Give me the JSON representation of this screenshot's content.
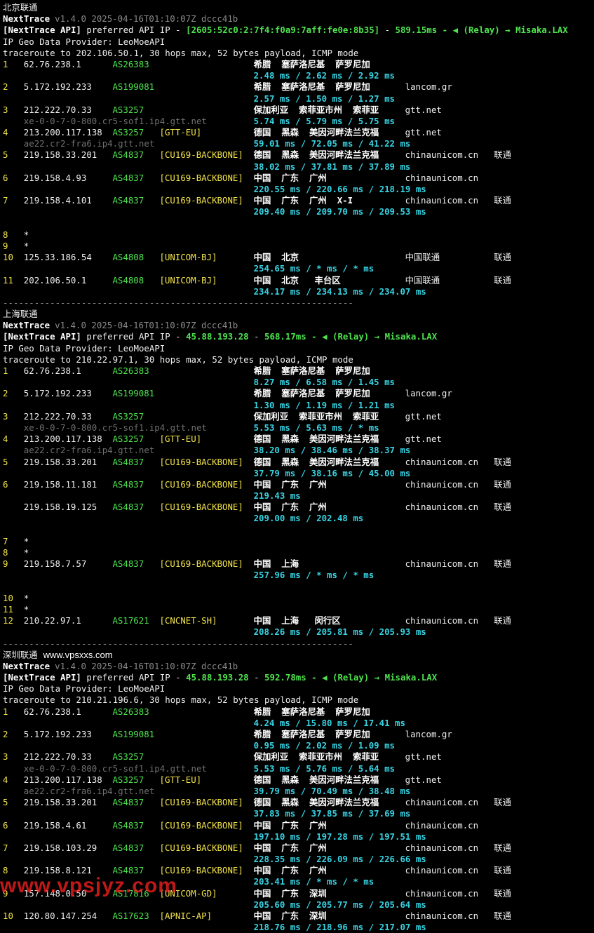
{
  "watermark": "www.vpsjyz.com",
  "site_tag": "www.vpsxxs.com",
  "blocks": [
    {
      "title": "北京联通",
      "version_name": "NextTrace",
      "version_info": "v1.4.0 2025-04-16T01:10:07Z dccc41b",
      "api_tag": "[NextTrace API]",
      "api_text": " preferred API IP - ",
      "api_ip": "[2605:52c0:2:7f4:f0a9:7aff:fe0e:8b35]",
      "api_sep": " - ",
      "api_latency": "589.15ms",
      "api_relay": " - ◀ (Relay) → Misaka.LAX",
      "geo_provider": "IP Geo Data Provider: LeoMoeAPI",
      "traceroute": "traceroute to 202.106.50.1, 30 hops max, 52 bytes payload, ICMP mode",
      "rows": [
        {
          "hop": "1",
          "ip": "62.76.238.1",
          "asn": "AS26383",
          "tag": "",
          "geo": "希腊  塞萨洛尼基  萨罗尼加",
          "domain": "",
          "isp": ""
        },
        {
          "rtt": "2.48 ms / 2.62 ms / 2.92 ms"
        },
        {
          "hop": "2",
          "ip": "5.172.192.233",
          "asn": "AS199081",
          "tag": "",
          "geo": "希腊  塞萨洛尼基  萨罗尼加",
          "domain": "lancom.gr",
          "isp": ""
        },
        {
          "rtt": "2.57 ms / 1.50 ms / 1.27 ms"
        },
        {
          "hop": "3",
          "ip": "212.222.70.33",
          "asn": "AS3257",
          "tag": "",
          "geo": "保加利亚  索菲亚市州  索菲亚",
          "domain": "gtt.net",
          "isp": ""
        },
        {
          "host": "xe-0-0-7-0-800.cr5-sof1.ip4.gtt.net",
          "rtt": "5.74 ms / 5.79 ms / 5.75 ms"
        },
        {
          "hop": "4",
          "ip": "213.200.117.138",
          "asn": "AS3257",
          "tag": "[GTT-EU]",
          "geo": "德国  黑森  美因河畔法兰克福",
          "domain": "gtt.net",
          "isp": ""
        },
        {
          "host": "ae22.cr2-fra6.ip4.gtt.net",
          "rtt": "59.01 ms / 72.05 ms / 41.22 ms"
        },
        {
          "hop": "5",
          "ip": "219.158.33.201",
          "asn": "AS4837",
          "tag": "[CU169-BACKBONE]",
          "geo": "德国  黑森  美因河畔法兰克福",
          "domain": "chinaunicom.cn",
          "isp": "联通"
        },
        {
          "rtt": "38.02 ms / 37.81 ms / 37.89 ms"
        },
        {
          "hop": "6",
          "ip": "219.158.4.93",
          "asn": "AS4837",
          "tag": "[CU169-BACKBONE]",
          "geo": "中国  广东  广州",
          "domain": "chinaunicom.cn",
          "isp": ""
        },
        {
          "rtt": "220.55 ms / 220.66 ms / 218.19 ms"
        },
        {
          "hop": "7",
          "ip": "219.158.4.101",
          "asn": "AS4837",
          "tag": "[CU169-BACKBONE]",
          "geo": "中国  广东  广州  X-I",
          "domain": "chinaunicom.cn",
          "isp": "联通"
        },
        {
          "rtt": "209.40 ms / 209.70 ms / 209.53 ms"
        },
        {
          "blank": true
        },
        {
          "hop": "8",
          "star": "*"
        },
        {
          "hop": "9",
          "star": "*"
        },
        {
          "hop": "10",
          "ip": "125.33.186.54",
          "asn": "AS4808",
          "tag": "[UNICOM-BJ]",
          "geo": "中国  北京",
          "domain": "中国联通",
          "isp": "联通"
        },
        {
          "rtt": "254.65 ms / * ms / * ms"
        },
        {
          "hop": "11",
          "ip": "202.106.50.1",
          "asn": "AS4808",
          "tag": "[UNICOM-BJ]",
          "geo": "中国  北京   丰台区",
          "domain": "中国联通",
          "isp": "联通"
        },
        {
          "rtt": "234.17 ms / 234.13 ms / 234.07 ms"
        }
      ],
      "separator": "-------------------------------------------------------------------"
    },
    {
      "title": "上海联通",
      "version_name": "NextTrace",
      "version_info": "v1.4.0 2025-04-16T01:10:07Z dccc41b",
      "api_tag": "[NextTrace API]",
      "api_text": " preferred API IP - ",
      "api_ip": "45.88.193.28",
      "api_sep": " - ",
      "api_latency": "568.17ms",
      "api_relay": " - ◀ (Relay) → Misaka.LAX",
      "geo_provider": "IP Geo Data Provider: LeoMoeAPI",
      "traceroute": "traceroute to 210.22.97.1, 30 hops max, 52 bytes payload, ICMP mode",
      "rows": [
        {
          "hop": "1",
          "ip": "62.76.238.1",
          "asn": "AS26383",
          "tag": "",
          "geo": "希腊  塞萨洛尼基  萨罗尼加",
          "domain": "",
          "isp": ""
        },
        {
          "rtt": "8.27 ms / 6.58 ms / 1.45 ms"
        },
        {
          "hop": "2",
          "ip": "5.172.192.233",
          "asn": "AS199081",
          "tag": "",
          "geo": "希腊  塞萨洛尼基  萨罗尼加",
          "domain": "lancom.gr",
          "isp": ""
        },
        {
          "rtt": "1.30 ms / 1.19 ms / 1.21 ms"
        },
        {
          "hop": "3",
          "ip": "212.222.70.33",
          "asn": "AS3257",
          "tag": "",
          "geo": "保加利亚  索菲亚市州  索菲亚",
          "domain": "gtt.net",
          "isp": ""
        },
        {
          "host": "xe-0-0-7-0-800.cr5-sof1.ip4.gtt.net",
          "rtt": "5.53 ms / 5.63 ms / * ms"
        },
        {
          "hop": "4",
          "ip": "213.200.117.138",
          "asn": "AS3257",
          "tag": "[GTT-EU]",
          "geo": "德国  黑森  美因河畔法兰克福",
          "domain": "gtt.net",
          "isp": ""
        },
        {
          "host": "ae22.cr2-fra6.ip4.gtt.net",
          "rtt": "38.20 ms / 38.46 ms / 38.37 ms"
        },
        {
          "hop": "5",
          "ip": "219.158.33.201",
          "asn": "AS4837",
          "tag": "[CU169-BACKBONE]",
          "geo": "德国  黑森  美因河畔法兰克福",
          "domain": "chinaunicom.cn",
          "isp": "联通"
        },
        {
          "rtt": "37.79 ms / 38.16 ms / 45.00 ms"
        },
        {
          "hop": "6",
          "ip": "219.158.11.181",
          "asn": "AS4837",
          "tag": "[CU169-BACKBONE]",
          "geo": "中国  广东  广州",
          "domain": "chinaunicom.cn",
          "isp": "联通"
        },
        {
          "rtt": "219.43 ms"
        },
        {
          "hop": "",
          "ip": "219.158.19.125",
          "asn": "AS4837",
          "tag": "[CU169-BACKBONE]",
          "geo": "中国  广东  广州",
          "domain": "chinaunicom.cn",
          "isp": "联通"
        },
        {
          "rtt": "209.00 ms / 202.48 ms"
        },
        {
          "blank": true
        },
        {
          "hop": "7",
          "star": "*"
        },
        {
          "hop": "8",
          "star": "*"
        },
        {
          "hop": "9",
          "ip": "219.158.7.57",
          "asn": "AS4837",
          "tag": "[CU169-BACKBONE]",
          "geo": "中国  上海",
          "domain": "chinaunicom.cn",
          "isp": "联通"
        },
        {
          "rtt": "257.96 ms / * ms / * ms"
        },
        {
          "blank": true
        },
        {
          "hop": "10",
          "star": "*"
        },
        {
          "hop": "11",
          "star": "*"
        },
        {
          "hop": "12",
          "ip": "210.22.97.1",
          "asn": "AS17621",
          "tag": "[CNCNET-SH]",
          "geo": "中国  上海   闵行区",
          "domain": "chinaunicom.cn",
          "isp": "联通"
        },
        {
          "rtt": "208.26 ms / 205.81 ms / 205.93 ms"
        }
      ],
      "separator": "-------------------------------------------------------------------"
    },
    {
      "title": "深圳联通",
      "version_name": "NextTrace",
      "version_info": "v1.4.0 2025-04-16T01:10:07Z dccc41b",
      "api_tag": "[NextTrace API]",
      "api_text": " preferred API IP - ",
      "api_ip": "45.88.193.28",
      "api_sep": " - ",
      "api_latency": "592.78ms",
      "api_relay": " - ◀ (Relay) → Misaka.LAX",
      "geo_provider": "IP Geo Data Provider: LeoMoeAPI",
      "traceroute": "traceroute to 210.21.196.6, 30 hops max, 52 bytes payload, ICMP mode",
      "rows": [
        {
          "hop": "1",
          "ip": "62.76.238.1",
          "asn": "AS26383",
          "tag": "",
          "geo": "希腊  塞萨洛尼基  萨罗尼加",
          "domain": "",
          "isp": ""
        },
        {
          "rtt": "4.24 ms / 15.80 ms / 17.41 ms"
        },
        {
          "hop": "2",
          "ip": "5.172.192.233",
          "asn": "AS199081",
          "tag": "",
          "geo": "希腊  塞萨洛尼基  萨罗尼加",
          "domain": "lancom.gr",
          "isp": ""
        },
        {
          "rtt": "0.95 ms / 2.02 ms / 1.09 ms"
        },
        {
          "hop": "3",
          "ip": "212.222.70.33",
          "asn": "AS3257",
          "tag": "",
          "geo": "保加利亚  索菲亚市州  索菲亚",
          "domain": "gtt.net",
          "isp": ""
        },
        {
          "host": "xe-0-0-7-0-800.cr5-sof1.ip4.gtt.net",
          "rtt": "5.53 ms / 5.76 ms / 5.64 ms"
        },
        {
          "hop": "4",
          "ip": "213.200.117.138",
          "asn": "AS3257",
          "tag": "[GTT-EU]",
          "geo": "德国  黑森  美因河畔法兰克福",
          "domain": "gtt.net",
          "isp": ""
        },
        {
          "host": "ae22.cr2-fra6.ip4.gtt.net",
          "rtt": "39.79 ms / 70.49 ms / 38.48 ms"
        },
        {
          "hop": "5",
          "ip": "219.158.33.201",
          "asn": "AS4837",
          "tag": "[CU169-BACKBONE]",
          "geo": "德国  黑森  美因河畔法兰克福",
          "domain": "chinaunicom.cn",
          "isp": "联通"
        },
        {
          "rtt": "37.83 ms / 37.85 ms / 37.69 ms"
        },
        {
          "hop": "6",
          "ip": "219.158.4.61",
          "asn": "AS4837",
          "tag": "[CU169-BACKBONE]",
          "geo": "中国  广东  广州",
          "domain": "chinaunicom.cn",
          "isp": ""
        },
        {
          "rtt": "197.10 ms / 197.28 ms / 197.51 ms"
        },
        {
          "hop": "7",
          "ip": "219.158.103.29",
          "asn": "AS4837",
          "tag": "[CU169-BACKBONE]",
          "geo": "中国  广东  广州",
          "domain": "chinaunicom.cn",
          "isp": "联通"
        },
        {
          "rtt": "228.35 ms / 226.09 ms / 226.66 ms"
        },
        {
          "hop": "8",
          "ip": "219.158.8.121",
          "asn": "AS4837",
          "tag": "[CU169-BACKBONE]",
          "geo": "中国  广东  广州",
          "domain": "chinaunicom.cn",
          "isp": "联通"
        },
        {
          "rtt": "203.41 ms / * ms / * ms"
        },
        {
          "hop": "9",
          "ip": "157.148.0.50",
          "asn": "AS17816",
          "tag": "[UNICOM-GD]",
          "geo": "中国  广东  深圳",
          "domain": "chinaunicom.cn",
          "isp": "联通"
        },
        {
          "rtt": "205.60 ms / 205.77 ms / 205.64 ms"
        },
        {
          "hop": "10",
          "ip": "120.80.147.254",
          "asn": "AS17623",
          "tag": "[APNIC-AP]",
          "geo": "中国  广东  深圳",
          "domain": "chinaunicom.cn",
          "isp": "联通"
        },
        {
          "rtt": "218.76 ms / 218.96 ms / 217.07 ms"
        }
      ],
      "separator": ""
    }
  ]
}
